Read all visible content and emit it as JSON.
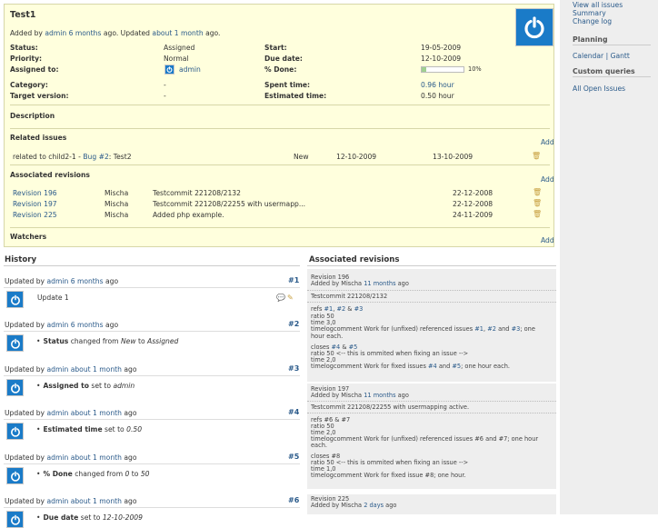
{
  "sidebar": {
    "links_top": [
      "View all issues",
      "Summary",
      "Change log"
    ],
    "planning_head": "Planning",
    "calendar": "Calendar",
    "divider": "|",
    "gantt": "Gantt",
    "custom_head": "Custom queries",
    "all_open": "All Open Issues"
  },
  "issue": {
    "title": "Test1",
    "added_prefix": "Added by",
    "added_user": "admin",
    "added_ago": "6 months",
    "updated_mid": "ago. Updated",
    "updated_ago": "about 1 month",
    "updated_suffix": "ago.",
    "fields": {
      "status_label": "Status:",
      "status": "Assigned",
      "priority_label": "Priority:",
      "priority": "Normal",
      "assigned_label": "Assigned to:",
      "assigned": "admin",
      "category_label": "Category:",
      "category": "-",
      "target_label": "Target version:",
      "target": "-",
      "start_label": "Start:",
      "start": "19-05-2009",
      "due_label": "Due date:",
      "due": "12-10-2009",
      "done_label": "% Done:",
      "done": "10%",
      "done_value": 10,
      "spent_label": "Spent time:",
      "spent": "0.96 hour",
      "estimated_label": "Estimated time:",
      "estimated": "0.50 hour"
    },
    "description_head": "Description",
    "related_head": "Related issues",
    "add": "Add",
    "related": {
      "prefix": "related to child2-1 -",
      "link": "Bug #2",
      "suffix": ": Test2",
      "status": "New",
      "start": "12-10-2009",
      "due": "13-10-2009"
    },
    "assoc_head": "Associated revisions",
    "revisions": [
      {
        "rev": "Revision 196",
        "author": "Mischa",
        "msg": "Testcommit 221208/2132",
        "date": "22-12-2008"
      },
      {
        "rev": "Revision 197",
        "author": "Mischa",
        "msg": "Testcommit 221208/22255 with usermapp...",
        "date": "22-12-2008"
      },
      {
        "rev": "Revision 225",
        "author": "Mischa",
        "msg": "Added php example.",
        "date": "24-11-2009"
      }
    ],
    "watchers_head": "Watchers"
  },
  "history": {
    "head": "History",
    "entries": [
      {
        "prefix": "Updated by",
        "user": "admin",
        "ago": "6 months",
        "suffix": "ago",
        "num": "#1",
        "note": "Update 1"
      },
      {
        "prefix": "Updated by",
        "user": "admin",
        "ago": "6 months",
        "suffix": "ago",
        "num": "#2",
        "field": "Status",
        "detail": "changed from",
        "from": "New",
        "to_word": "to",
        "to": "Assigned"
      },
      {
        "prefix": "Updated by",
        "user": "admin",
        "ago": "about 1 month",
        "suffix": "ago",
        "num": "#3",
        "field": "Assigned to",
        "detail": "set to",
        "value": "admin"
      },
      {
        "prefix": "Updated by",
        "user": "admin",
        "ago": "about 1 month",
        "suffix": "ago",
        "num": "#4",
        "field": "Estimated time",
        "detail": "set to",
        "value": "0.50"
      },
      {
        "prefix": "Updated by",
        "user": "admin",
        "ago": "about 1 month",
        "suffix": "ago",
        "num": "#5",
        "field": "% Done",
        "detail": "changed from",
        "from": "0",
        "to_word": "to",
        "to": "50"
      },
      {
        "prefix": "Updated by",
        "user": "admin",
        "ago": "about 1 month",
        "suffix": "ago",
        "num": "#6",
        "field": "Due date",
        "detail": "set to",
        "value": "12-10-2009"
      }
    ]
  },
  "assoc_panel": {
    "head": "Associated revisions",
    "rev196": {
      "title": "Revision 196",
      "added_prefix": "Added by Mischa",
      "ago": "11 months",
      "ago_suffix": "ago",
      "msg": "Testcommit 221208/2132",
      "refs_prefix": "refs",
      "refs_1": "#1",
      "refs_comma": ",",
      "refs_2": "#2",
      "refs_amp": "&",
      "refs_3": "#3",
      "ratio": "ratio 50",
      "time": "time 3,0",
      "timelog_a": "timelogcomment Work for (unfixed) referenced issues",
      "tl_1": "#1",
      "tl_comma": ",",
      "tl_2": "#2",
      "tl_and": "and",
      "tl_3": "#3",
      "timelog_b": "; one",
      "timelog_c": "hour each.",
      "closes_prefix": "closes",
      "c_4": "#4",
      "c_amp": "&",
      "c_5": "#5",
      "ratio2": "ratio 50 <-- this is ommited when fixing an issue -->",
      "time2": "time 2,0",
      "timelog2_a": "timelogcomment Work for fixed issues",
      "t2_4": "#4",
      "t2_and": "and",
      "t2_5": "#5",
      "timelog2_b": "; one hour each."
    },
    "rev197": {
      "title": "Revision 197",
      "added_prefix": "Added by Mischa",
      "ago": "11 months",
      "ago_suffix": "ago",
      "msg": "Testcommit 221208/22255 with usermapping active.",
      "refs": "refs #6 & #7",
      "ratio": "ratio 50",
      "time": "time 2,0",
      "timelog_a": "timelogcomment Work for (unfixed) referenced issues #6 and #7; one hour",
      "timelog_b": "each.",
      "closes": "closes #8",
      "ratio2": "ratio 50 <-- this is ommited when fixing an issue -->",
      "time2": "time 1,0",
      "timelog2": "timelogcomment Work for fixed issue #8; one hour."
    },
    "rev225": {
      "title": "Revision 225",
      "added_prefix": "Added by Mischa",
      "ago": "2 days",
      "ago_suffix": "ago"
    }
  },
  "colors": {
    "accent": "#2a5a8a",
    "issue_bg": "#ffffdd",
    "avatar": "#1a7bc8"
  }
}
